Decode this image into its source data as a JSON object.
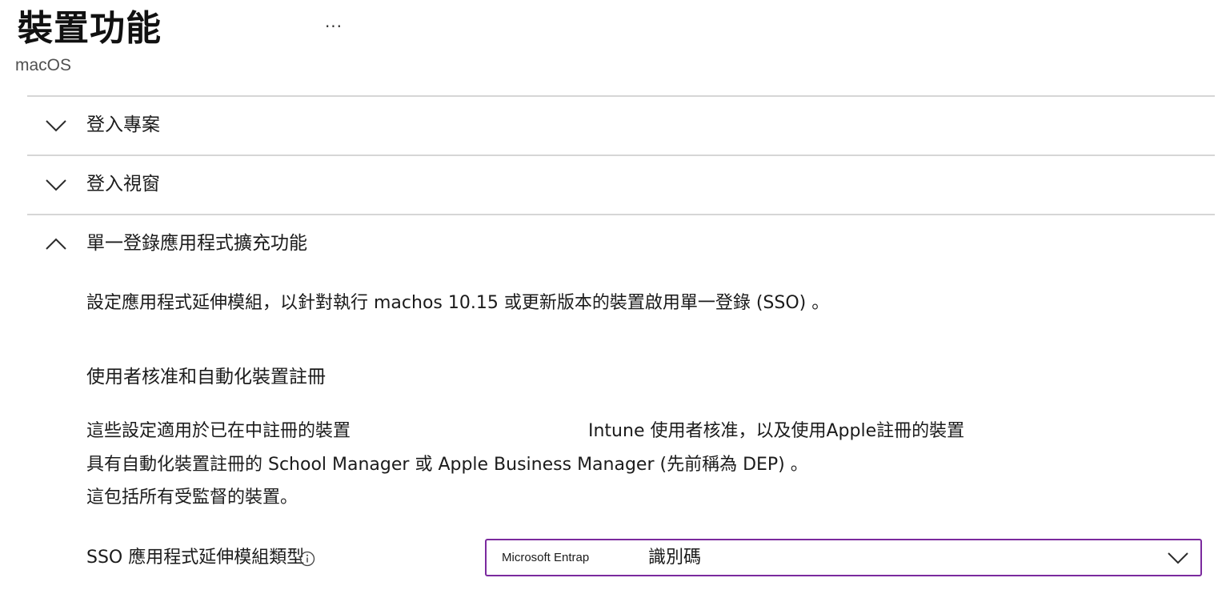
{
  "header": {
    "title": "裝置功能",
    "more_label": "···",
    "subtitle": "macOS"
  },
  "sections": [
    {
      "label": "登入專案",
      "expanded": false,
      "icon": "chevron-down-icon"
    },
    {
      "label": "登入視窗",
      "expanded": false,
      "icon": "chevron-down-icon"
    },
    {
      "label": "單一登錄應用程式擴充功能",
      "expanded": true,
      "icon": "chevron-up-icon"
    }
  ],
  "sso": {
    "description": "設定應用程式延伸模組，以針對執行 machos  10.15 或更新版本的裝置啟用單一登錄 (SSO) 。",
    "heading": "使用者核准和自動化裝置註冊",
    "body_line1a": "這些設定適用於已在中註冊的裝置",
    "body_line1b": "Intune 使用者核准，以及使用Apple註冊的裝置",
    "body_line2": "具有自動化裝置註冊的 School Manager 或 Apple Business Manager (先前稱為 DEP) 。",
    "body_line3": "這包括所有受監督的裝置。",
    "field_label": "SSO 應用程式延伸模組類型",
    "info_icon": "info-icon",
    "dropdown_small": "Microsoft Entrap",
    "dropdown_value": "識別碼",
    "dropdown_icon": "chevron-down-icon",
    "accent_color": "#7b2a9e"
  }
}
